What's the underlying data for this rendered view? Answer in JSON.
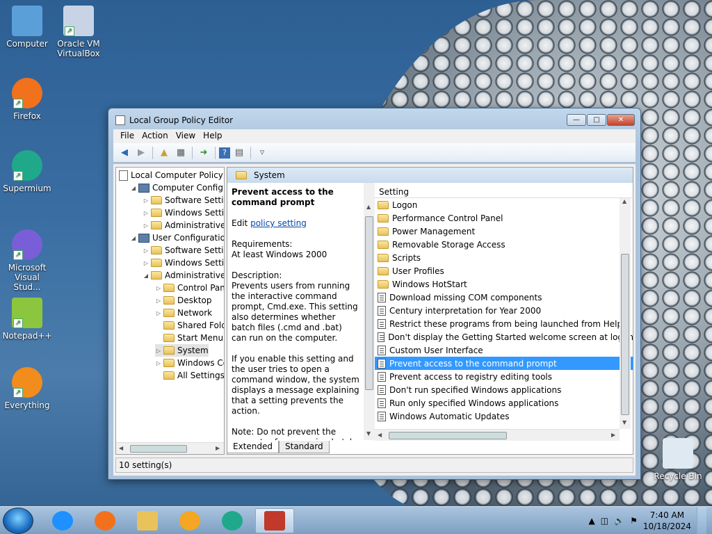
{
  "desktop": {
    "icons": [
      {
        "label": "Computer",
        "icon": "computer-icon"
      },
      {
        "label": "Oracle VM VirtualBox",
        "icon": "virtualbox-icon"
      },
      {
        "label": "Firefox",
        "icon": "firefox-icon"
      },
      {
        "label": "Supermium",
        "icon": "supermium-icon"
      },
      {
        "label": "Microsoft Visual Stud...",
        "icon": "visual-studio-icon"
      },
      {
        "label": "Notepad++",
        "icon": "notepadpp-icon"
      },
      {
        "label": "Everything",
        "icon": "everything-icon"
      },
      {
        "label": "Recycle Bin",
        "icon": "recycle-bin-icon"
      }
    ]
  },
  "window": {
    "title": "Local Group Policy Editor",
    "menu": [
      "File",
      "Action",
      "View",
      "Help"
    ],
    "tree": [
      {
        "label": "Local Computer Policy",
        "level": 0,
        "expander": ""
      },
      {
        "label": "Computer Configura",
        "level": 1,
        "expander": "open"
      },
      {
        "label": "Software Settings",
        "level": 2,
        "expander": "closed"
      },
      {
        "label": "Windows Setting",
        "level": 2,
        "expander": "closed"
      },
      {
        "label": "Administrative Te",
        "level": 2,
        "expander": "closed"
      },
      {
        "label": "User Configuration",
        "level": 1,
        "expander": "open"
      },
      {
        "label": "Software Settings",
        "level": 2,
        "expander": "closed"
      },
      {
        "label": "Windows Setting",
        "level": 2,
        "expander": "closed"
      },
      {
        "label": "Administrative Te",
        "level": 2,
        "expander": "open"
      },
      {
        "label": "Control Panel",
        "level": 3,
        "expander": "closed"
      },
      {
        "label": "Desktop",
        "level": 3,
        "expander": "closed"
      },
      {
        "label": "Network",
        "level": 3,
        "expander": "closed"
      },
      {
        "label": "Shared Folder",
        "level": 3,
        "expander": ""
      },
      {
        "label": "Start Menu ar",
        "level": 3,
        "expander": ""
      },
      {
        "label": "System",
        "level": 3,
        "expander": "closed",
        "selected": true
      },
      {
        "label": "Windows Cor",
        "level": 3,
        "expander": "closed"
      },
      {
        "label": "All Settings",
        "level": 3,
        "expander": ""
      }
    ],
    "pane_title": "System",
    "description": {
      "title": "Prevent access to the command prompt",
      "edit_prefix": "Edit",
      "edit_link": "policy setting",
      "requirements_label": "Requirements:",
      "requirements_value": "At least Windows 2000",
      "description_label": "Description:",
      "description_text": "Prevents users from running the interactive command prompt, Cmd.exe. This setting also determines whether batch files (.cmd and .bat) can run on the computer.",
      "enable_text": "If you enable this setting and the user tries to open a command window, the system displays a message explaining that a setting prevents the action.",
      "note_text": "Note: Do not prevent the computer from running batch"
    },
    "list_header": "Setting",
    "settings": [
      {
        "label": "Logon",
        "type": "folder"
      },
      {
        "label": "Performance Control Panel",
        "type": "folder"
      },
      {
        "label": "Power Management",
        "type": "folder"
      },
      {
        "label": "Removable Storage Access",
        "type": "folder"
      },
      {
        "label": "Scripts",
        "type": "folder"
      },
      {
        "label": "User Profiles",
        "type": "folder"
      },
      {
        "label": "Windows HotStart",
        "type": "folder"
      },
      {
        "label": "Download missing COM components",
        "type": "policy"
      },
      {
        "label": "Century interpretation for Year 2000",
        "type": "policy"
      },
      {
        "label": "Restrict these programs from being launched from Help",
        "type": "policy"
      },
      {
        "label": "Don't display the Getting Started welcome screen at logon",
        "type": "policy"
      },
      {
        "label": "Custom User Interface",
        "type": "policy"
      },
      {
        "label": "Prevent access to the command prompt",
        "type": "policy",
        "selected": true
      },
      {
        "label": "Prevent access to registry editing tools",
        "type": "policy"
      },
      {
        "label": "Don't run specified Windows applications",
        "type": "policy"
      },
      {
        "label": "Run only specified Windows applications",
        "type": "policy"
      },
      {
        "label": "Windows Automatic Updates",
        "type": "policy"
      }
    ],
    "tabs": [
      "Extended",
      "Standard"
    ],
    "status": "10 setting(s)"
  },
  "taskbar": {
    "apps": [
      "internet-explorer-icon",
      "firefox-icon",
      "file-explorer-icon",
      "media-player-icon",
      "supermium-icon",
      "group-policy-icon"
    ],
    "time": "7:40 AM",
    "date": "10/18/2024"
  }
}
